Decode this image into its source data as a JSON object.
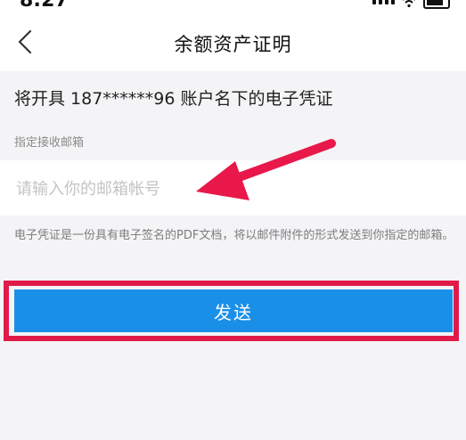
{
  "status_bar": {
    "time": "8:27",
    "icons": [
      "signal-icon",
      "wifi-icon",
      "battery-icon"
    ]
  },
  "nav": {
    "back_icon": "chevron-left-icon",
    "title": "余额资产证明"
  },
  "account": {
    "line": "将开具 187******96 账户名下的电子凭证"
  },
  "email": {
    "label": "指定接收邮箱",
    "placeholder": "请输入你的邮箱帐号",
    "value": ""
  },
  "help": {
    "text": "电子凭证是一份具有电子签名的PDF文档，将以邮件附件的形式发送到你指定的邮箱。"
  },
  "send": {
    "label": "发送"
  },
  "colors": {
    "accent": "#1a8fe8",
    "highlight": "#e01b4a",
    "background": "#f4f4f6"
  }
}
